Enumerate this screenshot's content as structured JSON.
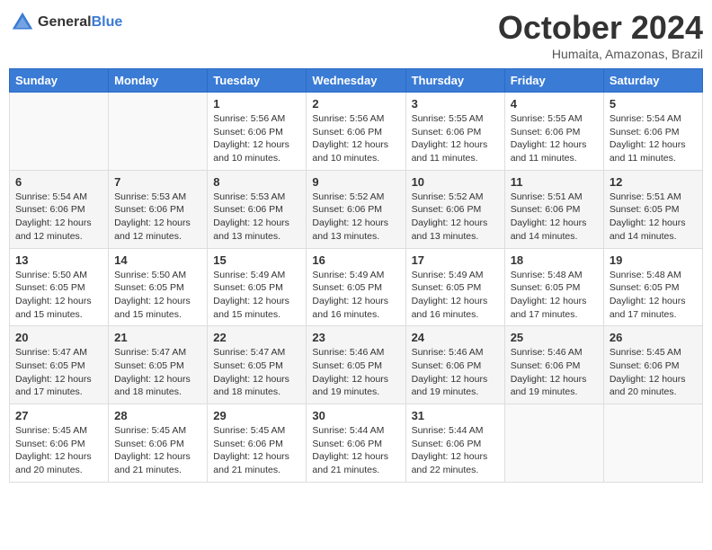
{
  "header": {
    "logo_line1": "General",
    "logo_line2": "Blue",
    "title": "October 2024",
    "subtitle": "Humaita, Amazonas, Brazil"
  },
  "days_of_week": [
    "Sunday",
    "Monday",
    "Tuesday",
    "Wednesday",
    "Thursday",
    "Friday",
    "Saturday"
  ],
  "weeks": [
    [
      {
        "day": "",
        "info": ""
      },
      {
        "day": "",
        "info": ""
      },
      {
        "day": "1",
        "info": "Sunrise: 5:56 AM\nSunset: 6:06 PM\nDaylight: 12 hours\nand 10 minutes."
      },
      {
        "day": "2",
        "info": "Sunrise: 5:56 AM\nSunset: 6:06 PM\nDaylight: 12 hours\nand 10 minutes."
      },
      {
        "day": "3",
        "info": "Sunrise: 5:55 AM\nSunset: 6:06 PM\nDaylight: 12 hours\nand 11 minutes."
      },
      {
        "day": "4",
        "info": "Sunrise: 5:55 AM\nSunset: 6:06 PM\nDaylight: 12 hours\nand 11 minutes."
      },
      {
        "day": "5",
        "info": "Sunrise: 5:54 AM\nSunset: 6:06 PM\nDaylight: 12 hours\nand 11 minutes."
      }
    ],
    [
      {
        "day": "6",
        "info": "Sunrise: 5:54 AM\nSunset: 6:06 PM\nDaylight: 12 hours\nand 12 minutes."
      },
      {
        "day": "7",
        "info": "Sunrise: 5:53 AM\nSunset: 6:06 PM\nDaylight: 12 hours\nand 12 minutes."
      },
      {
        "day": "8",
        "info": "Sunrise: 5:53 AM\nSunset: 6:06 PM\nDaylight: 12 hours\nand 13 minutes."
      },
      {
        "day": "9",
        "info": "Sunrise: 5:52 AM\nSunset: 6:06 PM\nDaylight: 12 hours\nand 13 minutes."
      },
      {
        "day": "10",
        "info": "Sunrise: 5:52 AM\nSunset: 6:06 PM\nDaylight: 12 hours\nand 13 minutes."
      },
      {
        "day": "11",
        "info": "Sunrise: 5:51 AM\nSunset: 6:06 PM\nDaylight: 12 hours\nand 14 minutes."
      },
      {
        "day": "12",
        "info": "Sunrise: 5:51 AM\nSunset: 6:05 PM\nDaylight: 12 hours\nand 14 minutes."
      }
    ],
    [
      {
        "day": "13",
        "info": "Sunrise: 5:50 AM\nSunset: 6:05 PM\nDaylight: 12 hours\nand 15 minutes."
      },
      {
        "day": "14",
        "info": "Sunrise: 5:50 AM\nSunset: 6:05 PM\nDaylight: 12 hours\nand 15 minutes."
      },
      {
        "day": "15",
        "info": "Sunrise: 5:49 AM\nSunset: 6:05 PM\nDaylight: 12 hours\nand 15 minutes."
      },
      {
        "day": "16",
        "info": "Sunrise: 5:49 AM\nSunset: 6:05 PM\nDaylight: 12 hours\nand 16 minutes."
      },
      {
        "day": "17",
        "info": "Sunrise: 5:49 AM\nSunset: 6:05 PM\nDaylight: 12 hours\nand 16 minutes."
      },
      {
        "day": "18",
        "info": "Sunrise: 5:48 AM\nSunset: 6:05 PM\nDaylight: 12 hours\nand 17 minutes."
      },
      {
        "day": "19",
        "info": "Sunrise: 5:48 AM\nSunset: 6:05 PM\nDaylight: 12 hours\nand 17 minutes."
      }
    ],
    [
      {
        "day": "20",
        "info": "Sunrise: 5:47 AM\nSunset: 6:05 PM\nDaylight: 12 hours\nand 17 minutes."
      },
      {
        "day": "21",
        "info": "Sunrise: 5:47 AM\nSunset: 6:05 PM\nDaylight: 12 hours\nand 18 minutes."
      },
      {
        "day": "22",
        "info": "Sunrise: 5:47 AM\nSunset: 6:05 PM\nDaylight: 12 hours\nand 18 minutes."
      },
      {
        "day": "23",
        "info": "Sunrise: 5:46 AM\nSunset: 6:05 PM\nDaylight: 12 hours\nand 19 minutes."
      },
      {
        "day": "24",
        "info": "Sunrise: 5:46 AM\nSunset: 6:06 PM\nDaylight: 12 hours\nand 19 minutes."
      },
      {
        "day": "25",
        "info": "Sunrise: 5:46 AM\nSunset: 6:06 PM\nDaylight: 12 hours\nand 19 minutes."
      },
      {
        "day": "26",
        "info": "Sunrise: 5:45 AM\nSunset: 6:06 PM\nDaylight: 12 hours\nand 20 minutes."
      }
    ],
    [
      {
        "day": "27",
        "info": "Sunrise: 5:45 AM\nSunset: 6:06 PM\nDaylight: 12 hours\nand 20 minutes."
      },
      {
        "day": "28",
        "info": "Sunrise: 5:45 AM\nSunset: 6:06 PM\nDaylight: 12 hours\nand 21 minutes."
      },
      {
        "day": "29",
        "info": "Sunrise: 5:45 AM\nSunset: 6:06 PM\nDaylight: 12 hours\nand 21 minutes."
      },
      {
        "day": "30",
        "info": "Sunrise: 5:44 AM\nSunset: 6:06 PM\nDaylight: 12 hours\nand 21 minutes."
      },
      {
        "day": "31",
        "info": "Sunrise: 5:44 AM\nSunset: 6:06 PM\nDaylight: 12 hours\nand 22 minutes."
      },
      {
        "day": "",
        "info": ""
      },
      {
        "day": "",
        "info": ""
      }
    ]
  ]
}
